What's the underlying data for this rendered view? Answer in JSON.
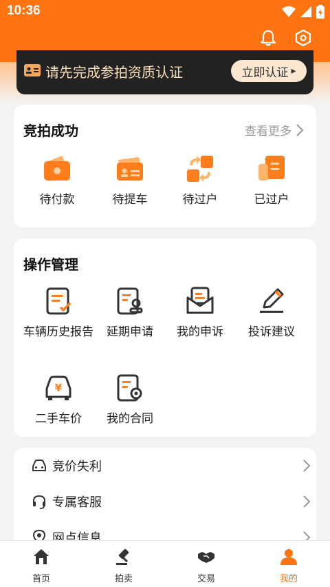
{
  "status_bar": {
    "time": "10:36"
  },
  "header": {
    "bell_icon": "bell-icon",
    "settings_icon": "settings-icon"
  },
  "cert_banner": {
    "text": "请先完成参拍资质认证",
    "button_label": "立即认证",
    "arrow": "▸"
  },
  "auction_success": {
    "title": "竞拍成功",
    "more_label": "查看更多",
    "items": [
      {
        "label": "待付款",
        "icon": "wallet-icon"
      },
      {
        "label": "待提车",
        "icon": "card-icon"
      },
      {
        "label": "待过户",
        "icon": "transfer-icon"
      },
      {
        "label": "已过户",
        "icon": "document-icon"
      }
    ]
  },
  "operations": {
    "title": "操作管理",
    "items": [
      {
        "label": "车辆历史报告",
        "icon": "report-icon"
      },
      {
        "label": "延期申请",
        "icon": "extension-icon"
      },
      {
        "label": "我的申诉",
        "icon": "appeal-icon"
      },
      {
        "label": "投诉建议",
        "icon": "pen-icon"
      },
      {
        "label": "二手车价",
        "icon": "car-price-icon"
      },
      {
        "label": "我的合同",
        "icon": "contract-icon"
      }
    ]
  },
  "menu_list": [
    {
      "label": "竞价失利",
      "icon": "car-icon"
    },
    {
      "label": "专属客服",
      "icon": "headset-icon"
    },
    {
      "label": "网点信息",
      "icon": "location-icon"
    }
  ],
  "tabbar": [
    {
      "label": "首页",
      "icon": "home-icon",
      "active": false
    },
    {
      "label": "拍卖",
      "icon": "gavel-icon",
      "active": false
    },
    {
      "label": "交易",
      "icon": "handshake-icon",
      "active": false
    },
    {
      "label": "我的",
      "icon": "user-icon",
      "active": true
    }
  ],
  "colors": {
    "accent": "#ff7410",
    "banner_bg": "#222222",
    "banner_text": "#f8dcb8"
  }
}
